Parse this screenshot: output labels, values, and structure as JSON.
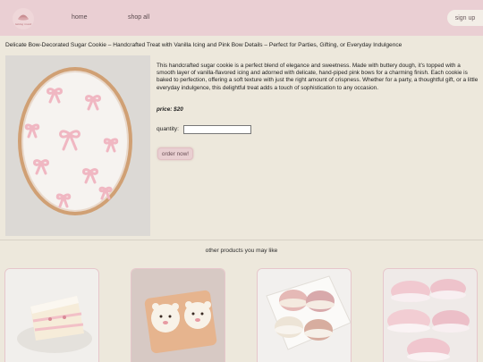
{
  "header": {
    "logo_text": "baking round",
    "nav": {
      "home": "home",
      "shop_all": "shop all"
    },
    "signup_label": "sign up"
  },
  "product": {
    "title": "Delicate Bow-Decorated Sugar Cookie – Handcrafted Treat with Vanilla Icing and Pink Bow Details – Perfect for Parties, Gifting, or Everyday Indulgence",
    "description": "This handcrafted sugar cookie is a perfect blend of elegance and sweetness. Made with buttery dough, it's topped with a smooth layer of vanilla-flavored icing and adorned with delicate, hand-piped pink bows for a charming finish. Each cookie is baked to perfection, offering a soft texture with just the right amount of crispness. Whether for a party, a thoughtful gift, or a little everyday indulgence, this delightful treat adds a touch of sophistication to any occasion.",
    "price": "price: $20",
    "quantity_label": "quantity:",
    "quantity_value": "",
    "order_label": "order now!"
  },
  "related": {
    "title": "other products you may like"
  },
  "colors": {
    "header_bg": "#eacfd3",
    "page_bg": "#ede8dc",
    "accent_pink": "#e9cfd1"
  }
}
